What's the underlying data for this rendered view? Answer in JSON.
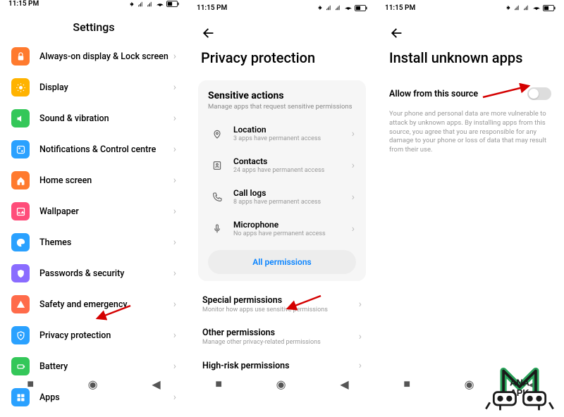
{
  "status": {
    "time": "11:15 PM"
  },
  "p1": {
    "title": "Settings",
    "groupA": [
      {
        "label": "Always-on display & Lock screen",
        "color": "#ff7a2e",
        "icon": "lock"
      },
      {
        "label": "Display",
        "color": "#ffb300",
        "icon": "sun"
      },
      {
        "label": "Sound & vibration",
        "color": "#34c759",
        "icon": "speaker"
      },
      {
        "label": "Notifications & Control centre",
        "color": "#2aa1ff",
        "icon": "sliders"
      },
      {
        "label": "Home screen",
        "color": "#ff7a2e",
        "icon": "home"
      },
      {
        "label": "Wallpaper",
        "color": "#ff4d7a",
        "icon": "image"
      },
      {
        "label": "Themes",
        "color": "#2aa1ff",
        "icon": "palette"
      }
    ],
    "groupB": [
      {
        "label": "Passwords & security",
        "color": "#8a6cff",
        "icon": "shield"
      },
      {
        "label": "Safety and emergency",
        "color": "#ff6b4a",
        "icon": "warning"
      },
      {
        "label": "Privacy protection",
        "color": "#2aa1ff",
        "icon": "privacy"
      },
      {
        "label": "Battery",
        "color": "#34c759",
        "icon": "battery"
      },
      {
        "label": "Apps",
        "color": "#2aa1ff",
        "icon": "apps"
      }
    ]
  },
  "p2": {
    "title": "Privacy protection",
    "card_title": "Sensitive actions",
    "card_sub": "Manage apps that request sensitive permissions",
    "perms": [
      {
        "name": "Location",
        "sub": "3 apps have permanent access"
      },
      {
        "name": "Contacts",
        "sub": "24 apps have permanent access"
      },
      {
        "name": "Call logs",
        "sub": "8 apps have permanent access"
      },
      {
        "name": "Microphone",
        "sub": "No apps have permanent access"
      }
    ],
    "all": "All permissions",
    "rows": [
      {
        "name": "Special permissions",
        "sub": "Monitor how apps use sensitive permissions"
      },
      {
        "name": "Other permissions",
        "sub": "Manage other privacy-related permissions"
      },
      {
        "name": "High-risk permissions",
        "sub": ""
      }
    ]
  },
  "p3": {
    "title": "Install unknown apps",
    "toggle_label": "Allow from this source",
    "warning": "Your phone and personal data are more vulnerable to attack by unknown apps. By installing apps from this source, you agree that you are responsible for any damage to your phone or loss of data that may result from their use."
  },
  "logo_text": "ANA\nAPK"
}
